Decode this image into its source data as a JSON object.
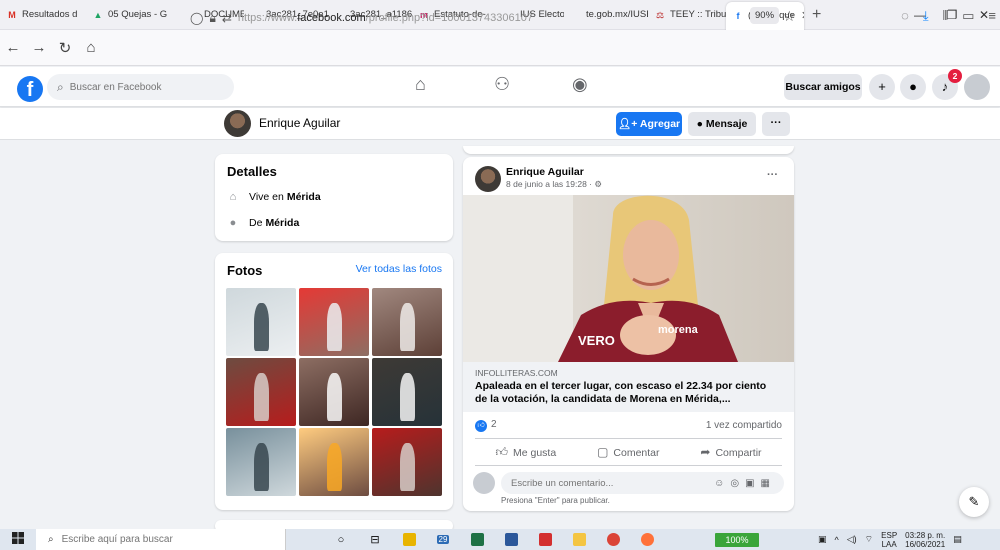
{
  "browser": {
    "tabs": [
      {
        "label": "Resultados d",
        "fav": "M",
        "color": "#d93025"
      },
      {
        "label": "05 Quejas - G",
        "fav": "▲",
        "color": "#1fa463"
      },
      {
        "label": "DOCUMENTO",
        "fav": "",
        "color": "#888"
      },
      {
        "label": "3ac281_7e0e1d5f",
        "fav": "",
        "color": "#888"
      },
      {
        "label": "3ac281_a1186d1e",
        "fav": "",
        "color": "#888"
      },
      {
        "label": "Estatuto-de-",
        "fav": "m",
        "color": "#c2185b"
      },
      {
        "label": "IUS Electoral",
        "fav": "",
        "color": "#888"
      },
      {
        "label": "te.gob.mx/IUSEap",
        "fav": "",
        "color": "#888"
      },
      {
        "label": "TEEY :: Tribun",
        "fav": "⚖",
        "color": "#b71c1c"
      },
      {
        "label": "(2) Enrique",
        "fav": "f",
        "color": "#1877f2",
        "active": true
      }
    ],
    "url_prefix": "https://www.",
    "url_host": "facebook.com",
    "url_path": "/profile.php?id=100013743306107",
    "zoom": "90%"
  },
  "fb": {
    "logo": "f",
    "search_placeholder": "Buscar en Facebook",
    "find_friends": "Buscar amigos",
    "notif_count": "2"
  },
  "profile": {
    "name": "Enrique Aguilar",
    "add_label": "Agregar",
    "message_label": "Mensaje",
    "more_label": "···"
  },
  "details": {
    "title": "Detalles",
    "lives_prefix": "Vive en",
    "lives_city": "Mérida",
    "from_prefix": "De",
    "from_city": "Mérida"
  },
  "photos": {
    "title": "Fotos",
    "see_all": "Ver todas las fotos"
  },
  "post": {
    "author": "Enrique Aguilar",
    "date": "8 de junio a las 19:28 · ⚙",
    "more": "···",
    "image_overlay_left": "VERO",
    "image_overlay_right": "morena",
    "link_source": "INFOLLITERAS.COM",
    "link_title_1": "Apaleada en el tercer lugar, con escaso el 22.34 por ciento",
    "link_title_2": "de la votación, la candidata de Morena en Mérida,...",
    "like_count": "2",
    "share_count": "1 vez compartido",
    "like_label": "Me gusta",
    "comment_label": "Comentar",
    "share_label": "Compartir",
    "comment_placeholder": "Escribe un comentario...",
    "comment_hint": "Presiona \"Enter\" para publicar."
  },
  "taskbar": {
    "search_placeholder": "Escribe aquí para buscar",
    "battery": "100%",
    "lang_1": "ESP",
    "lang_2": "LAA",
    "time": "03:28 p. m.",
    "date": "16/06/2021",
    "weather_temp": "29"
  }
}
